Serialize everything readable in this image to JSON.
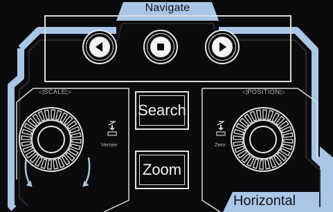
{
  "navigate": {
    "title": "Navigate",
    "buttons": [
      {
        "name": "previous",
        "icon": "play-left-icon"
      },
      {
        "name": "stop",
        "icon": "stop-square-icon"
      },
      {
        "name": "next",
        "icon": "play-right-icon"
      }
    ]
  },
  "scale": {
    "label": "SCALE",
    "press_label": "Vernier",
    "icon": "press-knob-icon"
  },
  "position": {
    "label": "POSITION",
    "press_label": "Zero",
    "icon": "press-knob-icon"
  },
  "buttons": {
    "search_label": "Search",
    "zoom_label": "Zoom"
  },
  "section": {
    "title": "Horizontal"
  },
  "colors": {
    "accent_blue": "#a9c6e6",
    "panel_bg": "#0b0b0d",
    "line": "#dcdcdc"
  }
}
